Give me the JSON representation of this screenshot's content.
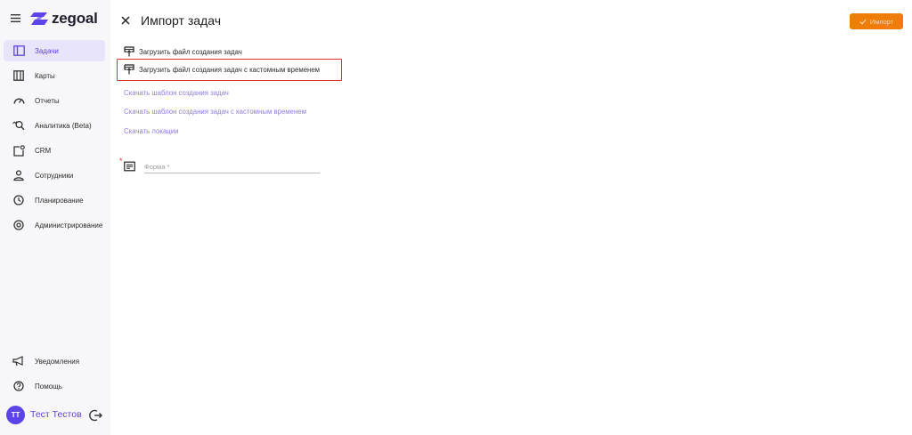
{
  "app": {
    "name": "zegoal"
  },
  "sidebar": {
    "items": [
      {
        "label": "Задачи",
        "icon": "tasks-icon",
        "active": true
      },
      {
        "label": "Карты",
        "icon": "map-icon",
        "active": false
      },
      {
        "label": "Отчеты",
        "icon": "gauge-icon",
        "active": false
      },
      {
        "label": "Аналитика (Beta)",
        "icon": "analytics-search-icon",
        "active": false
      },
      {
        "label": "CRM",
        "icon": "crm-icon",
        "active": false
      },
      {
        "label": "Сотрудники",
        "icon": "employees-icon",
        "active": false
      },
      {
        "label": "Планирование",
        "icon": "clock-icon",
        "active": false
      },
      {
        "label": "Администрирование",
        "icon": "settings-icon",
        "active": false
      }
    ],
    "bottom": [
      {
        "label": "Уведомления",
        "icon": "megaphone-icon"
      },
      {
        "label": "Помощь",
        "icon": "help-icon"
      }
    ],
    "user": {
      "initials": "ТТ",
      "name": "Тест Тестов"
    }
  },
  "header": {
    "title": "Импорт задач",
    "import_label": "Импорт"
  },
  "main": {
    "uploads": [
      {
        "label": "Загрузить файл создания задач"
      },
      {
        "label": "Загрузить файл создания задач с кастомным временем"
      }
    ],
    "links": [
      {
        "label": "Скачать шаблон создания задач"
      },
      {
        "label": "Скачать шаблон создания задач с кастомным временем"
      },
      {
        "label": "Скачать локации"
      }
    ],
    "form_field": {
      "placeholder": "Форма *",
      "required_mark": "*"
    }
  },
  "colors": {
    "accent": "#5b44e8",
    "active_bg": "#e8e4fb",
    "import_button": "#ef7d0a",
    "link": "#8b7ee8",
    "highlight": "#e22d2d",
    "sidebar_bg": "#f7f7f9"
  }
}
